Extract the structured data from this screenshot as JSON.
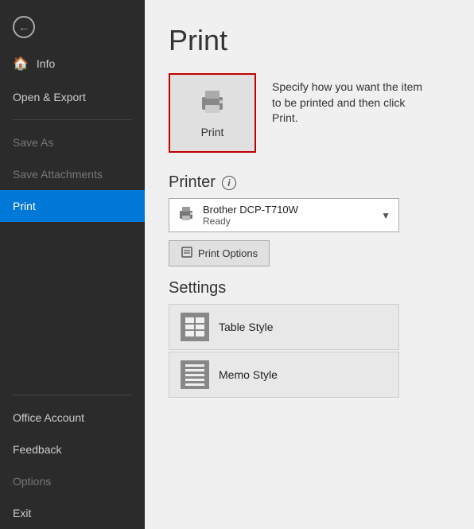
{
  "sidebar": {
    "back_label": "Back",
    "items": [
      {
        "id": "info",
        "label": "Info",
        "icon": "🏠",
        "active": false,
        "dimmed": false
      },
      {
        "id": "open-export",
        "label": "Open & Export",
        "icon": "",
        "active": false,
        "dimmed": false
      },
      {
        "id": "save-as",
        "label": "Save As",
        "icon": "",
        "active": false,
        "dimmed": true
      },
      {
        "id": "save-attachments",
        "label": "Save Attachments",
        "icon": "",
        "active": false,
        "dimmed": true
      },
      {
        "id": "print",
        "label": "Print",
        "icon": "",
        "active": true,
        "dimmed": false
      }
    ],
    "bottom_items": [
      {
        "id": "office-account",
        "label": "Office Account",
        "dimmed": false
      },
      {
        "id": "feedback",
        "label": "Feedback",
        "dimmed": false
      },
      {
        "id": "options",
        "label": "Options",
        "dimmed": true
      },
      {
        "id": "exit",
        "label": "Exit",
        "dimmed": false
      }
    ]
  },
  "main": {
    "title": "Print",
    "print_button_label": "Print",
    "print_description": "Specify how you want the item to be printed and then click Print.",
    "printer_section_label": "Printer",
    "printer_name": "Brother DCP-T710W",
    "printer_status": "Ready",
    "print_options_label": "Print Options",
    "settings_label": "Settings",
    "style_options": [
      {
        "id": "table-style",
        "label": "Table Style"
      },
      {
        "id": "memo-style",
        "label": "Memo Style"
      }
    ]
  }
}
